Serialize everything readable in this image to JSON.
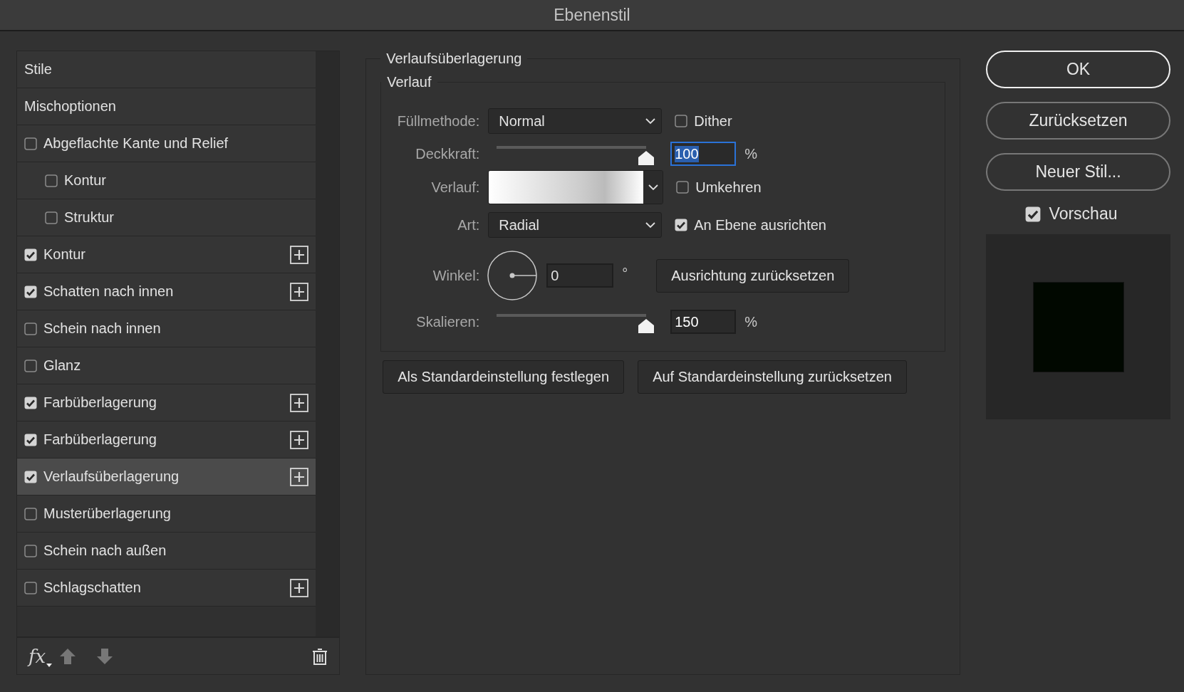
{
  "window": {
    "title": "Ebenenstil"
  },
  "styles_list": {
    "items": [
      {
        "label": "Stile",
        "kind": "header",
        "selected": false
      },
      {
        "label": "Mischoptionen",
        "kind": "header",
        "selected": false
      },
      {
        "label": "Abgeflachte Kante und Relief",
        "kind": "effect",
        "checked": false,
        "selected": false,
        "addable": false,
        "children": [
          {
            "label": "Kontur",
            "kind": "effect",
            "checked": false,
            "selected": false,
            "addable": false
          },
          {
            "label": "Struktur",
            "kind": "effect",
            "checked": false,
            "selected": false,
            "addable": false
          }
        ]
      },
      {
        "label": "Kontur",
        "kind": "effect",
        "checked": true,
        "selected": false,
        "addable": true
      },
      {
        "label": "Schatten nach innen",
        "kind": "effect",
        "checked": true,
        "selected": false,
        "addable": true
      },
      {
        "label": "Schein nach innen",
        "kind": "effect",
        "checked": false,
        "selected": false,
        "addable": false
      },
      {
        "label": "Glanz",
        "kind": "effect",
        "checked": false,
        "selected": false,
        "addable": false
      },
      {
        "label": "Farbüberlagerung",
        "kind": "effect",
        "checked": true,
        "selected": false,
        "addable": true
      },
      {
        "label": "Farbüberlagerung",
        "kind": "effect",
        "checked": true,
        "selected": false,
        "addable": true
      },
      {
        "label": "Verlaufsüberlagerung",
        "kind": "effect",
        "checked": true,
        "selected": true,
        "addable": true
      },
      {
        "label": "Musterüberlagerung",
        "kind": "effect",
        "checked": false,
        "selected": false,
        "addable": false
      },
      {
        "label": "Schein nach außen",
        "kind": "effect",
        "checked": false,
        "selected": false,
        "addable": false
      },
      {
        "label": "Schlagschatten",
        "kind": "effect",
        "checked": false,
        "selected": false,
        "addable": true
      }
    ],
    "footer": {
      "fx_label": "fx"
    }
  },
  "settings": {
    "title": "Verlaufsüberlagerung",
    "group_title": "Verlauf",
    "fill_method": {
      "label": "Füllmethode:",
      "value": "Normal"
    },
    "dither": {
      "label": "Dither",
      "checked": false
    },
    "opacity": {
      "label": "Deckkraft:",
      "level": 1,
      "value": "100",
      "unit": "%",
      "focused": true
    },
    "gradient": {
      "label": "Verlauf:"
    },
    "reverse": {
      "label": "Umkehren",
      "checked": false
    },
    "style": {
      "label": "Art:",
      "value": "Radial"
    },
    "align": {
      "label": "An Ebene ausrichten",
      "checked": true
    },
    "angle": {
      "label": "Winkel:",
      "value": "0",
      "unit": "°"
    },
    "reset_alignment": "Ausrichtung zurücksetzen",
    "scale": {
      "label": "Skalieren:",
      "level": 1,
      "value": "150",
      "unit": "%",
      "focused": false
    },
    "buttons": [
      "Als Standardeinstellung festlegen",
      "Auf Standardeinstellung zurücksetzen"
    ]
  },
  "actions": {
    "buttons": [
      {
        "label": "OK",
        "default": true
      },
      {
        "label": "Zurücksetzen",
        "default": false
      },
      {
        "label": "Neuer Stil...",
        "default": false
      }
    ],
    "preview": {
      "label": "Vorschau",
      "checked": true
    }
  }
}
